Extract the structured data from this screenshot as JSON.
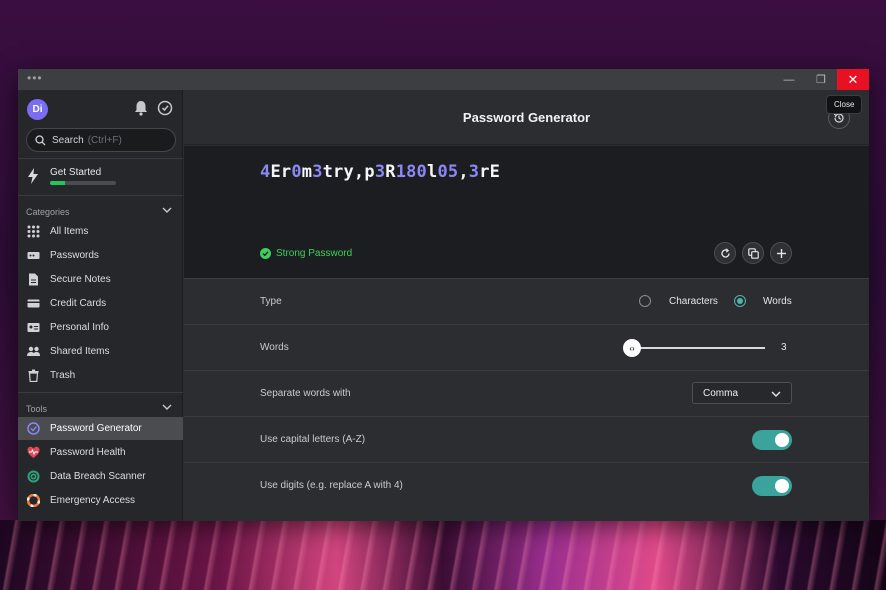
{
  "window": {
    "title_dots": "•••",
    "minimize": "—",
    "maximize": "❐",
    "close": "✕",
    "close_tooltip": "Close"
  },
  "sidebar": {
    "avatar_initials": "Di",
    "search": {
      "label": "Search",
      "shortcut": "(Ctrl+F)"
    },
    "get_started": {
      "label": "Get Started",
      "progress": 0.22
    },
    "categories_heading": "Categories",
    "categories": [
      {
        "label": "All Items",
        "icon": "grid-icon"
      },
      {
        "label": "Passwords",
        "icon": "password-icon"
      },
      {
        "label": "Secure Notes",
        "icon": "note-icon"
      },
      {
        "label": "Credit Cards",
        "icon": "credit-card-icon"
      },
      {
        "label": "Personal Info",
        "icon": "id-card-icon"
      },
      {
        "label": "Shared Items",
        "icon": "users-icon"
      },
      {
        "label": "Trash",
        "icon": "trash-icon"
      }
    ],
    "tools_heading": "Tools",
    "tools": [
      {
        "label": "Password Generator",
        "icon": "generator-icon",
        "active": true
      },
      {
        "label": "Password Health",
        "icon": "health-icon"
      },
      {
        "label": "Data Breach Scanner",
        "icon": "scanner-icon"
      },
      {
        "label": "Emergency Access",
        "icon": "lifebuoy-icon"
      }
    ]
  },
  "main": {
    "title": "Password Generator",
    "password_segments": [
      {
        "t": "4",
        "hl": true
      },
      {
        "t": "Er",
        "hl": false
      },
      {
        "t": "0",
        "hl": true
      },
      {
        "t": "m",
        "hl": false
      },
      {
        "t": "3",
        "hl": true
      },
      {
        "t": "try,p",
        "hl": false
      },
      {
        "t": "3",
        "hl": true
      },
      {
        "t": "R",
        "hl": false
      },
      {
        "t": "180",
        "hl": true
      },
      {
        "t": "l",
        "hl": false
      },
      {
        "t": "05",
        "hl": true
      },
      {
        "t": ",",
        "hl": false
      },
      {
        "t": "3",
        "hl": true
      },
      {
        "t": "rE",
        "hl": false
      }
    ],
    "strength_label": "Strong Password",
    "options": {
      "type_label": "Type",
      "type_characters": "Characters",
      "type_words": "Words",
      "type_selected": "Words",
      "words_label": "Words",
      "words_value": "3",
      "separator_label": "Separate words with",
      "separator_value": "Comma",
      "capital_label": "Use capital letters (A-Z)",
      "capital_on": true,
      "digits_label": "Use digits (e.g. replace A with 4)",
      "digits_on": true
    }
  },
  "colors": {
    "accent_purple": "#8b87f5",
    "strong_green": "#3fcf5a",
    "toggle_teal": "#3aa39b",
    "close_red": "#e81123"
  }
}
